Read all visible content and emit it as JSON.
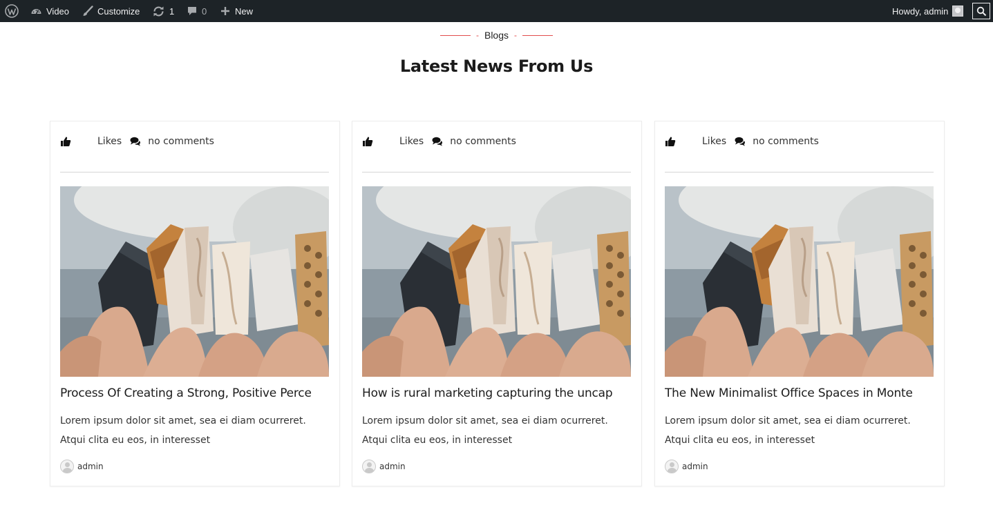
{
  "adminbar": {
    "wp_logo_icon": "wordpress-icon",
    "site_name": "Video",
    "customize_label": "Customize",
    "updates_count": "1",
    "comments_count": "0",
    "new_label": "New",
    "howdy_label": "Howdy, admin"
  },
  "section": {
    "kicker": "Blogs",
    "heading": "Latest News From Us",
    "accent_color": "#e24d4d"
  },
  "posts": [
    {
      "likes_label": "Likes",
      "comments_label": "no comments",
      "title": "Process Of Creating a Strong, Positive Perce",
      "excerpt": "Lorem ipsum dolor sit amet, sea ei diam ocurreret. Atqui clita eu eos, in interesset",
      "author": "admin"
    },
    {
      "likes_label": "Likes",
      "comments_label": "no comments",
      "title": "How is rural marketing capturing the uncap",
      "excerpt": "Lorem ipsum dolor sit amet, sea ei diam ocurreret. Atqui clita eu eos, in interesset",
      "author": "admin"
    },
    {
      "likes_label": "Likes",
      "comments_label": "no comments",
      "title": "The New Minimalist Office Spaces in Monte",
      "excerpt": "Lorem ipsum dolor sit amet, sea ei diam ocurreret. Atqui clita eu eos, in interesset",
      "author": "admin"
    }
  ]
}
